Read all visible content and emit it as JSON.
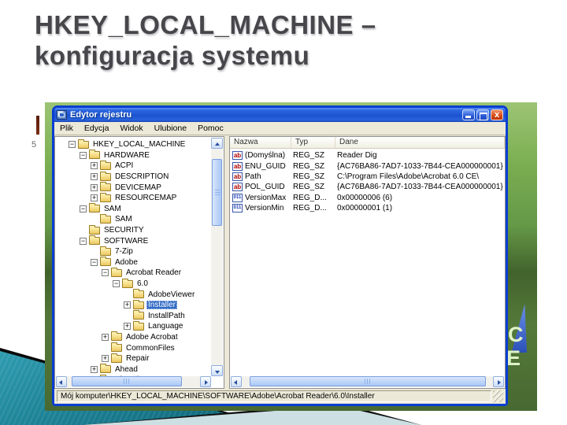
{
  "slide": {
    "title_line1": "HKEY_LOCAL_MACHINE –",
    "title_line2": "konfiguracja systemu",
    "stray_text": "5"
  },
  "desktop": {
    "letters": [
      "C",
      "E"
    ]
  },
  "window": {
    "title": "Edytor rejestru",
    "close_glyph": "x",
    "menus": [
      "Plik",
      "Edycja",
      "Widok",
      "Ulubione",
      "Pomoc"
    ],
    "status_path": "Mój komputer\\HKEY_LOCAL_MACHINE\\SOFTWARE\\Adobe\\Acrobat Reader\\6.0\\Installer"
  },
  "tree": {
    "items": [
      {
        "label": "HKEY_LOCAL_MACHINE",
        "level": 1,
        "expander": "minus"
      },
      {
        "label": "HARDWARE",
        "level": 2,
        "expander": "minus"
      },
      {
        "label": "ACPI",
        "level": 3,
        "expander": "plus"
      },
      {
        "label": "DESCRIPTION",
        "level": 3,
        "expander": "plus"
      },
      {
        "label": "DEVICEMAP",
        "level": 3,
        "expander": "plus"
      },
      {
        "label": "RESOURCEMAP",
        "level": 3,
        "expander": "plus"
      },
      {
        "label": "SAM",
        "level": 2,
        "expander": "minus"
      },
      {
        "label": "SAM",
        "level": 3,
        "expander": "none"
      },
      {
        "label": "SECURITY",
        "level": 2,
        "expander": "none"
      },
      {
        "label": "SOFTWARE",
        "level": 2,
        "expander": "minus"
      },
      {
        "label": "7-Zip",
        "level": 3,
        "expander": "none"
      },
      {
        "label": "Adobe",
        "level": 3,
        "expander": "minus"
      },
      {
        "label": "Acrobat Reader",
        "level": 4,
        "expander": "minus"
      },
      {
        "label": "6.0",
        "level": 5,
        "expander": "minus"
      },
      {
        "label": "AdobeViewer",
        "level": 6,
        "expander": "none"
      },
      {
        "label": "Installer",
        "level": 6,
        "expander": "plus",
        "selected": true
      },
      {
        "label": "InstallPath",
        "level": 6,
        "expander": "none"
      },
      {
        "label": "Language",
        "level": 6,
        "expander": "plus"
      },
      {
        "label": "Adobe Acrobat",
        "level": 4,
        "expander": "plus"
      },
      {
        "label": "CommonFiles",
        "level": 4,
        "expander": "none"
      },
      {
        "label": "Repair",
        "level": 4,
        "expander": "plus"
      },
      {
        "label": "Ahead",
        "level": 3,
        "expander": "plus"
      },
      {
        "label": "Alcatel",
        "level": 3,
        "expander": "plus",
        "clipped": true
      }
    ]
  },
  "list": {
    "columns": [
      "Nazwa",
      "Typ",
      "Dane"
    ],
    "rows": [
      {
        "icon": "string-value-icon",
        "name": "(Domyślna)",
        "type": "REG_SZ",
        "data": "Reader Dig"
      },
      {
        "icon": "string-value-icon",
        "name": "ENU_GUID",
        "type": "REG_SZ",
        "data": "{AC76BA86-7AD7-1033-7B44-CEA000000001}"
      },
      {
        "icon": "string-value-icon",
        "name": "Path",
        "type": "REG_SZ",
        "data": "C:\\Program Files\\Adobe\\Acrobat 6.0 CE\\"
      },
      {
        "icon": "string-value-icon",
        "name": "POL_GUID",
        "type": "REG_SZ",
        "data": "{AC76BA86-7AD7-1033-7B44-CEA000000001}"
      },
      {
        "icon": "dword-value-icon",
        "name": "VersionMax",
        "type": "REG_D...",
        "data": "0x00000006 (6)"
      },
      {
        "icon": "dword-value-icon",
        "name": "VersionMin",
        "type": "REG_D...",
        "data": "0x00000001 (1)"
      }
    ]
  },
  "colors": {
    "selection_blue": "#316ac5",
    "titlebar_blue": "#1c53d0",
    "window_border_blue": "#0a3ed2",
    "close_button_red": "#d84a16",
    "desktop_green": "#659847",
    "slide_teal": "#1b7f93",
    "title_text_gray": "#47474b"
  }
}
